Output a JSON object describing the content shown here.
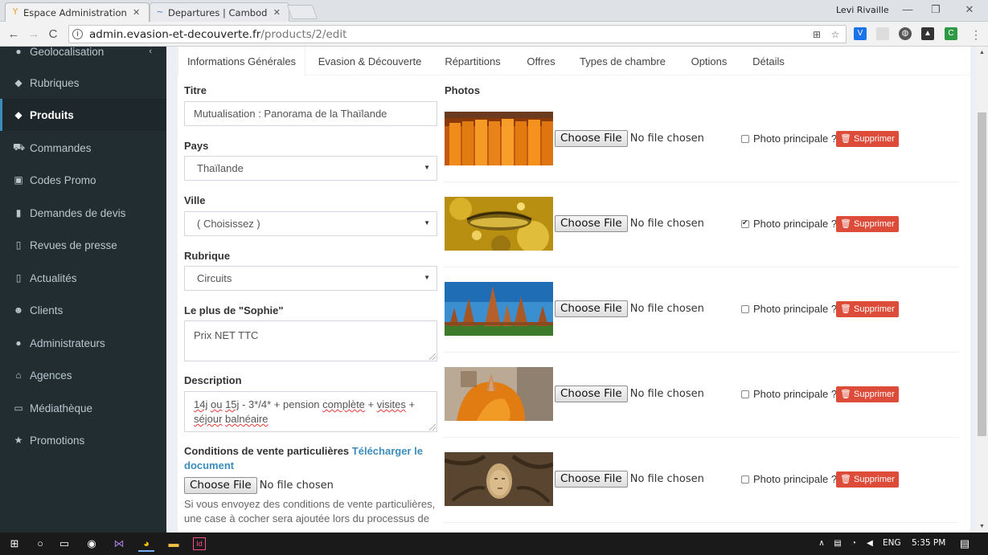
{
  "browser": {
    "tabs": [
      {
        "title": "Espace Administration - |",
        "active": true
      },
      {
        "title": "Departures | Cambodia /",
        "active": false
      }
    ],
    "profile_name": "Levi Rivaille",
    "url_host": "admin.evasion-et-decouverte.fr",
    "url_path": "/products/2/edit"
  },
  "sidebar": {
    "items": [
      {
        "label": "Geolocalisation",
        "icon": "globe-icon",
        "active": false
      },
      {
        "label": "Rubriques",
        "icon": "tag-icon",
        "active": false
      },
      {
        "label": "Produits",
        "icon": "tag-icon",
        "active": true
      },
      {
        "label": "Commandes",
        "icon": "cart-icon",
        "active": false
      },
      {
        "label": "Codes Promo",
        "icon": "ticket-icon",
        "active": false
      },
      {
        "label": "Demandes de devis",
        "icon": "file-icon",
        "active": false
      },
      {
        "label": "Revues de presse",
        "icon": "file-outline-icon",
        "active": false
      },
      {
        "label": "Actualités",
        "icon": "file-outline-icon",
        "active": false
      },
      {
        "label": "Clients",
        "icon": "users-icon",
        "active": false
      },
      {
        "label": "Administrateurs",
        "icon": "user-icon",
        "active": false
      },
      {
        "label": "Agences",
        "icon": "bank-icon",
        "active": false
      },
      {
        "label": "Médiathèque",
        "icon": "folder-icon",
        "active": false
      },
      {
        "label": "Promotions",
        "icon": "star-icon",
        "active": false
      }
    ]
  },
  "content_tabs": [
    "Informations Générales",
    "Evasion & Découverte",
    "Répartitions",
    "Offres",
    "Types de chambre",
    "Options",
    "Détails"
  ],
  "form": {
    "titre_label": "Titre",
    "titre_value": "Mutualisation : Panorama de la Thaïlande",
    "pays_label": "Pays",
    "pays_value": "Thaïlande",
    "ville_label": "Ville",
    "ville_value": "( Choisissez )",
    "rubrique_label": "Rubrique",
    "rubrique_value": "Circuits",
    "sophie_label": "Le plus de \"Sophie\"",
    "sophie_value": "Prix NET TTC",
    "description_label": "Description",
    "description_value_parts": [
      "14j",
      " ",
      "ou",
      " ",
      "15j",
      " - 3*/4* + pension ",
      "complète",
      " + ",
      "visites",
      " + ",
      "séjour",
      " ",
      "balnéaire"
    ],
    "conditions_label": "Conditions de vente particulières",
    "conditions_link": "Télécharger le document",
    "choose_file": "Choose File",
    "no_file": "No file chosen",
    "conditions_help": "Si vous envoyez des conditions de vente particulières, une case à cocher sera ajoutée lors du processus de"
  },
  "photos": {
    "heading": "Photos",
    "choose_file": "Choose File",
    "no_file": "No file chosen",
    "main_label": "Photo principale ?",
    "delete_label": "Supprimer",
    "items": [
      {
        "subject": "monks-orange-robes",
        "main": false
      },
      {
        "subject": "gold-leaf-buddha-eye",
        "main": true
      },
      {
        "subject": "ayutthaya-temple",
        "main": false
      },
      {
        "subject": "monk-praying-hands",
        "main": false
      },
      {
        "subject": "buddha-head-tree-roots",
        "main": false
      }
    ]
  },
  "taskbar": {
    "language": "ENG",
    "time": "5:35 PM"
  },
  "colors": {
    "sidebar_bg": "#222d32",
    "active_border": "#3c8dbc",
    "delete_red": "#dd4b39",
    "link_blue": "#3c8dbc"
  }
}
